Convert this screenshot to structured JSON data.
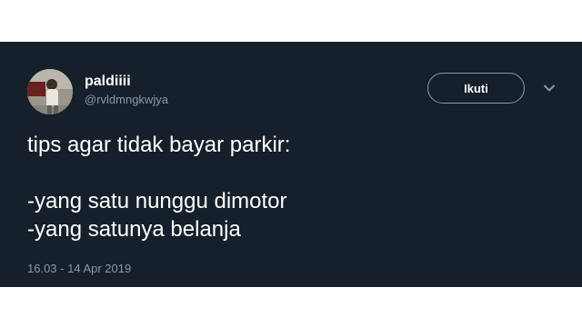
{
  "tweet": {
    "display_name": "paldiiii",
    "handle": "@rvldmngkwjya",
    "follow_label": "Ikuti",
    "text_lines": [
      "tips agar tidak bayar parkir:",
      "",
      "-yang satu nunggu dimotor",
      "-yang satunya belanja"
    ],
    "timestamp": "16.03 - 14 Apr 2019"
  },
  "icons": {
    "avatar": "user-avatar-photo",
    "menu": "chevron-down-icon"
  },
  "colors": {
    "background": "#15202b",
    "primary_text": "#ffffff",
    "secondary_text": "#8899a6"
  }
}
